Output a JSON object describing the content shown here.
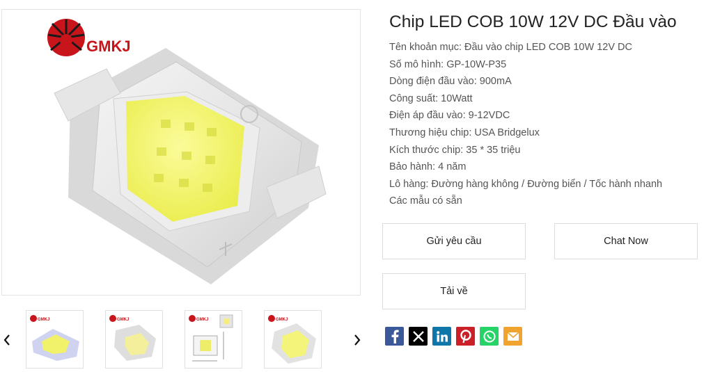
{
  "product": {
    "title": "Chip LED COB 10W 12V DC Đầu vào",
    "specs": [
      "Tên khoản mục: Đầu vào chip LED COB 10W 12V DC",
      "Số mô hình: GP-10W-P35",
      "Dòng điện đầu vào: 900mA",
      "Công suất: 10Watt",
      "Điện áp đầu vào: 9-12VDC",
      "Thương hiệu chip: USA Bridgelux",
      "Kích thước chip: 35 * 35 triệu",
      "Bảo hành: 4 năm",
      "Lô hàng: Đường hàng không / Đường biển / Tốc hành nhanh",
      "Các mẫu có sẵn"
    ]
  },
  "gallery": {
    "logo_text": "GMKJ",
    "thumbnails": [
      {
        "logo_text": "GMKJ"
      },
      {
        "logo_text": "GMKJ"
      },
      {
        "logo_text": "GMKJ"
      },
      {
        "logo_text": "GMKJ"
      }
    ]
  },
  "buttons": {
    "inquiry": "Gửi yêu cầu",
    "chat": "Chat Now",
    "download": "Tải về"
  },
  "share": [
    {
      "icon": "facebook-icon",
      "color": "#3b5998"
    },
    {
      "icon": "x-icon",
      "color": "#000000"
    },
    {
      "icon": "linkedin-icon",
      "color": "#0e76a8"
    },
    {
      "icon": "pinterest-icon",
      "color": "#cb2027"
    },
    {
      "icon": "whatsapp-icon",
      "color": "#25d366"
    },
    {
      "icon": "email-icon",
      "color": "#f0a32f"
    }
  ]
}
